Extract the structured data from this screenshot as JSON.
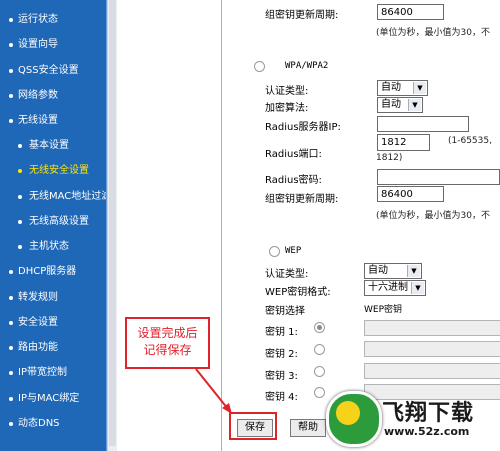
{
  "sidebar": {
    "items": [
      {
        "label": "运行状态",
        "level": 1,
        "active": false
      },
      {
        "label": "设置向导",
        "level": 1,
        "active": false
      },
      {
        "label": "QSS安全设置",
        "level": 1,
        "active": false
      },
      {
        "label": "网络参数",
        "level": 1,
        "active": false
      },
      {
        "label": "无线设置",
        "level": 1,
        "active": false
      },
      {
        "label": "基本设置",
        "level": 2,
        "active": false
      },
      {
        "label": "无线安全设置",
        "level": 2,
        "active": true
      },
      {
        "label": "无线MAC地址过滤",
        "level": 2,
        "active": false
      },
      {
        "label": "无线高级设置",
        "level": 2,
        "active": false
      },
      {
        "label": "主机状态",
        "level": 2,
        "active": false
      },
      {
        "label": "DHCP服务器",
        "level": 1,
        "active": false
      },
      {
        "label": "转发规则",
        "level": 1,
        "active": false
      },
      {
        "label": "安全设置",
        "level": 1,
        "active": false
      },
      {
        "label": "路由功能",
        "level": 1,
        "active": false
      },
      {
        "label": "IP带宽控制",
        "level": 1,
        "active": false
      },
      {
        "label": "IP与MAC绑定",
        "level": 1,
        "active": false
      },
      {
        "label": "动态DNS",
        "level": 1,
        "active": false
      }
    ]
  },
  "top": {
    "group_key_label": "组密钥更新周期:",
    "group_key_value": "86400",
    "hint": "(单位为秒，最小值为30，不"
  },
  "wpa": {
    "title": "WPA/WPA2",
    "auth_label": "认证类型:",
    "auth_value": "自动",
    "enc_label": "加密算法:",
    "enc_value": "自动",
    "radius_ip_label": "Radius服务器IP:",
    "radius_ip_value": "",
    "radius_port_label": "Radius端口:",
    "radius_port_value": "1812",
    "radius_port_hint": "(1-65535,",
    "radius_port_hint2": "1812)",
    "radius_pwd_label": "Radius密码:",
    "radius_pwd_value": "",
    "group_key_label": "组密钥更新周期:",
    "group_key_value": "86400",
    "hint": "(单位为秒，最小值为30，不"
  },
  "wep": {
    "title": "WEP",
    "auth_label": "认证类型:",
    "auth_value": "自动",
    "fmt_label": "WEP密钥格式:",
    "fmt_value": "十六进制",
    "key_select_label": "密钥选择",
    "wep_key_label": "WEP密钥",
    "keys": [
      {
        "label": "密钥 1:",
        "checked": true
      },
      {
        "label": "密钥 2:",
        "checked": false
      },
      {
        "label": "密钥 3:",
        "checked": false
      },
      {
        "label": "密钥 4:",
        "checked": false
      }
    ]
  },
  "buttons": {
    "save": "保存",
    "help": "帮助"
  },
  "annotation": {
    "line1": "设置完成后",
    "line2": "记得保存"
  },
  "watermark": {
    "title": "飞翔下载",
    "url": "www.52z.com"
  },
  "colors": {
    "sidebar_bg": "#1f67b7",
    "active_nav": "#ffe600",
    "annotation_red": "#e0222a"
  }
}
